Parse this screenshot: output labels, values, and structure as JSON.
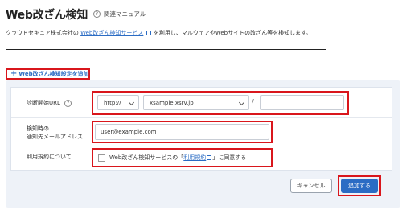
{
  "header": {
    "title": "Web改ざん検知",
    "help_icon": "question-circle-icon",
    "help_label": "関連マニュアル"
  },
  "description": {
    "prefix": "クラウドセキュア株式会社の",
    "link": "Web改ざん検知サービス",
    "suffix": "を利用し、マルウェアやWebサイトの改ざん等を検知します。"
  },
  "add_setting_link": {
    "icon": "plus-icon",
    "label": "Web改ざん検知設定を追加"
  },
  "form": {
    "url": {
      "label": "診断開始URL",
      "protocol_value": "http://",
      "domain_value": "xsample.xsrv.jp",
      "separator": "/",
      "path_value": ""
    },
    "email": {
      "label_line1": "検知時の",
      "label_line2": "通知先メールアドレス",
      "value": "user@example.com"
    },
    "terms": {
      "label": "利用規約について",
      "text_prefix": "Web改ざん検知サービスの「",
      "link": "利用規約",
      "text_suffix": "」に同意する",
      "checked": false
    }
  },
  "buttons": {
    "cancel": "キャンセル",
    "add": "追加する"
  },
  "colors": {
    "accent": "#2b6cc4",
    "highlight": "#d9161c",
    "panel_bg": "#eef2f8"
  }
}
